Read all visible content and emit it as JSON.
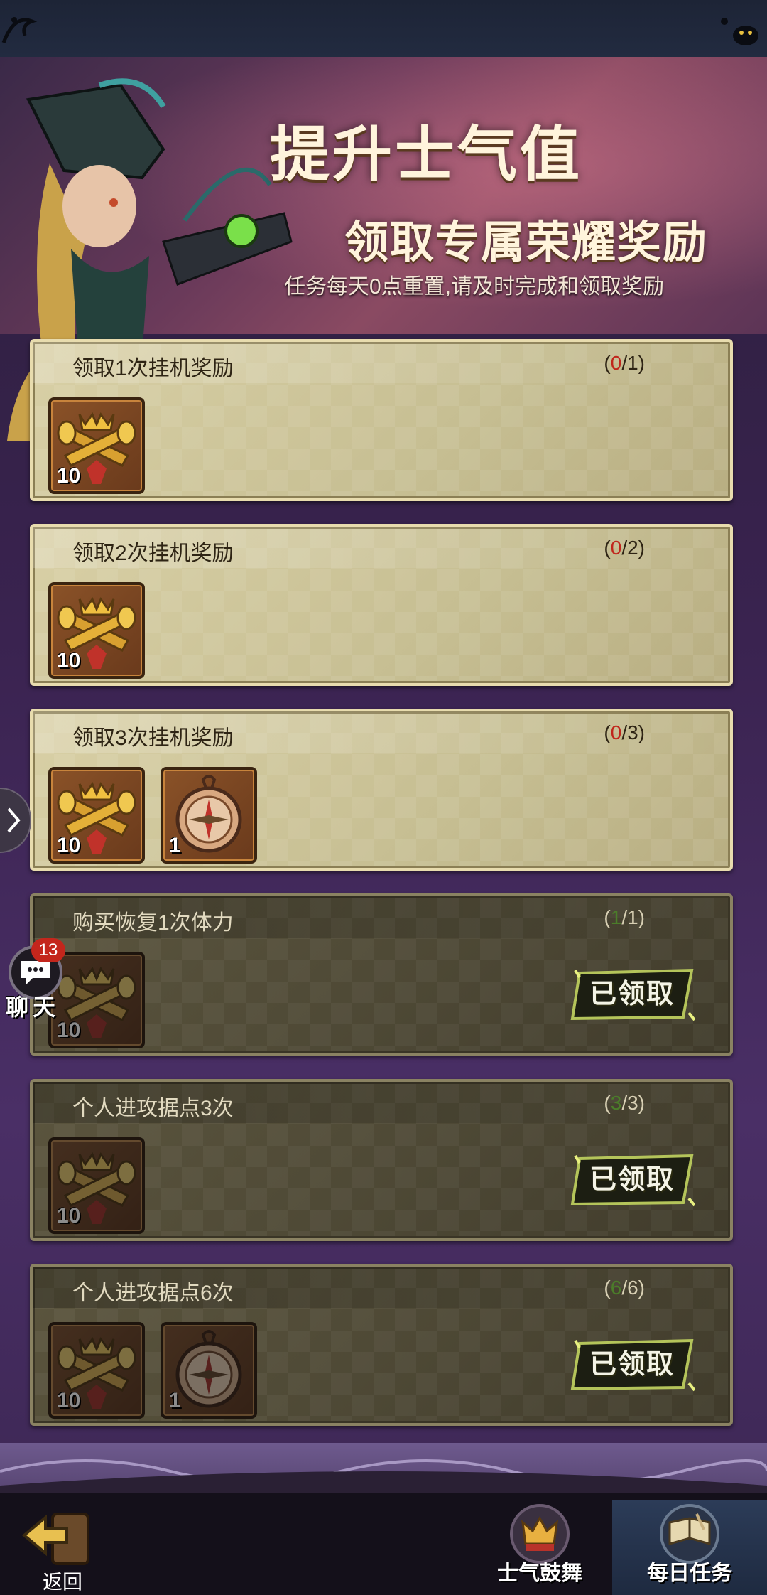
{
  "banner": {
    "title_line1": "提升士气值",
    "title_line2": "领取专属荣耀奖励",
    "subtitle": "任务每天0点重置,请及时完成和领取奖励"
  },
  "tasks": [
    {
      "name": "领取1次挂机奖励",
      "progress_current": "0",
      "progress_total": "1",
      "status": "active",
      "rewards": [
        {
          "icon": "horn-trumpets-icon",
          "qty": "10"
        }
      ]
    },
    {
      "name": "领取2次挂机奖励",
      "progress_current": "0",
      "progress_total": "2",
      "status": "active",
      "rewards": [
        {
          "icon": "horn-trumpets-icon",
          "qty": "10"
        }
      ]
    },
    {
      "name": "领取3次挂机奖励",
      "progress_current": "0",
      "progress_total": "3",
      "status": "active",
      "rewards": [
        {
          "icon": "horn-trumpets-icon",
          "qty": "10"
        },
        {
          "icon": "compass-icon",
          "qty": "1"
        }
      ]
    },
    {
      "name": "购买恢复1次体力",
      "progress_current": "1",
      "progress_total": "1",
      "status": "claimed",
      "rewards": [
        {
          "icon": "horn-trumpets-icon",
          "qty": "10"
        }
      ]
    },
    {
      "name": "个人进攻据点3次",
      "progress_current": "3",
      "progress_total": "3",
      "status": "claimed",
      "rewards": [
        {
          "icon": "horn-trumpets-icon",
          "qty": "10"
        }
      ]
    },
    {
      "name": "个人进攻据点6次",
      "progress_current": "6",
      "progress_total": "6",
      "status": "claimed",
      "rewards": [
        {
          "icon": "horn-trumpets-icon",
          "qty": "10"
        },
        {
          "icon": "compass-icon",
          "qty": "1"
        }
      ]
    }
  ],
  "claimed_label": "已领取",
  "chat": {
    "label": "聊天",
    "badge": "13"
  },
  "bottom": {
    "back_label": "返回",
    "tab_morale": "士气鼓舞",
    "tab_daily": "每日任务"
  },
  "colors": {
    "progress_zero": "#c0261c",
    "progress_done": "#4b7d2a"
  }
}
